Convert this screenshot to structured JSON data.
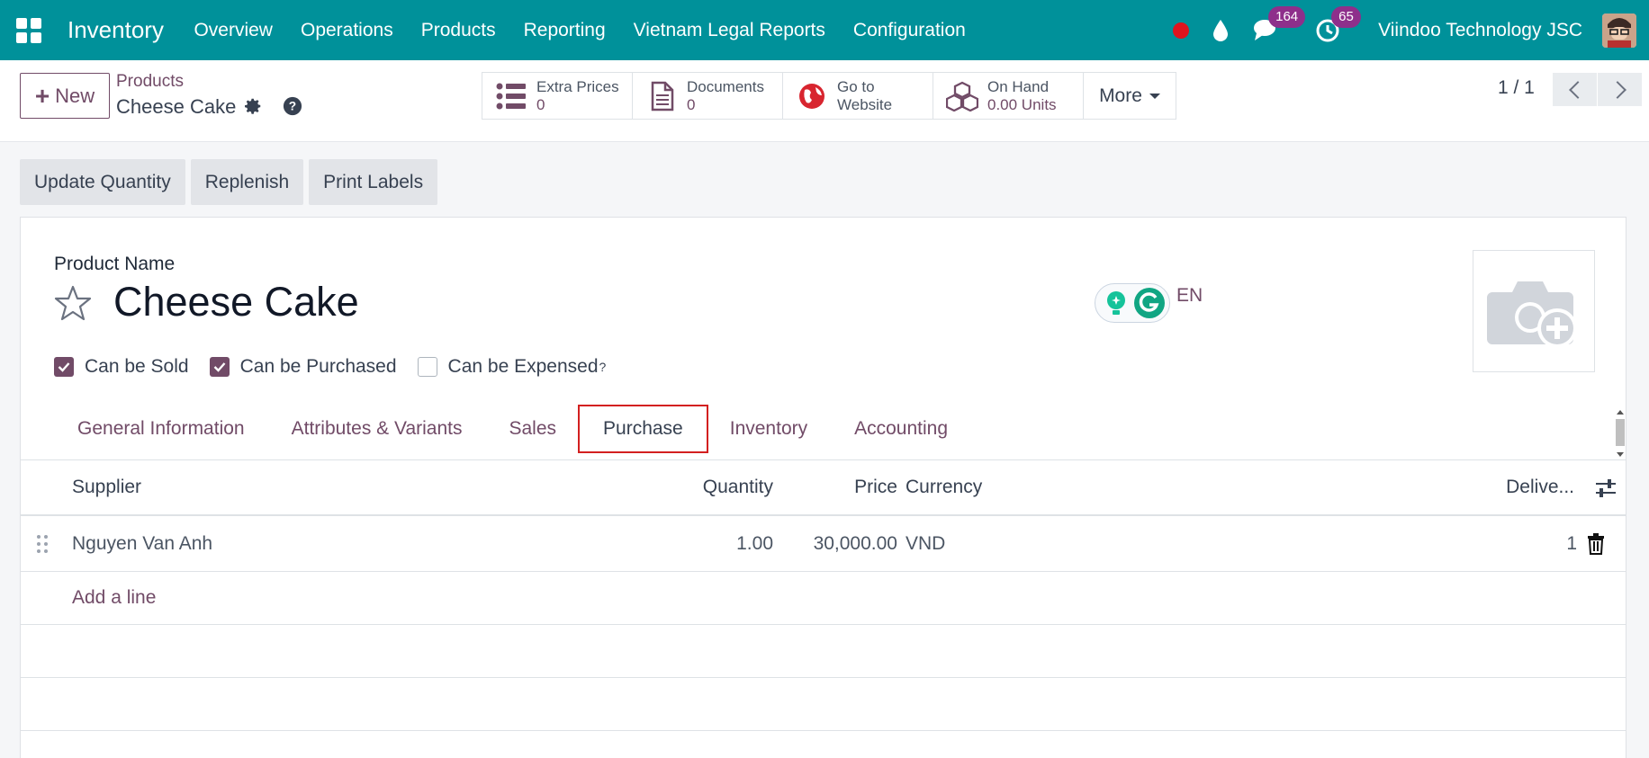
{
  "navbar": {
    "app_name": "Inventory",
    "menu": [
      "Overview",
      "Operations",
      "Products",
      "Reporting",
      "Vietnam Legal Reports",
      "Configuration"
    ],
    "messages_count": "164",
    "activities_count": "65",
    "company": "Viindoo Technology JSC",
    "accent": "#00919a",
    "badge_color": "#8e2f8b"
  },
  "control": {
    "new_label": "New",
    "breadcrumb_parent": "Products",
    "breadcrumb_current": "Cheese Cake",
    "smart_buttons": [
      {
        "icon": "list-icon",
        "label": "Extra Prices",
        "value": "0"
      },
      {
        "icon": "document-icon",
        "label": "Documents",
        "value": "0"
      },
      {
        "icon": "globe-icon",
        "label": "Go to",
        "value": "Website"
      },
      {
        "icon": "cubes-icon",
        "label": "On Hand",
        "value": "0.00 Units"
      }
    ],
    "more_label": "More",
    "pager": "1 / 1"
  },
  "actions": [
    "Update Quantity",
    "Replenish",
    "Print Labels"
  ],
  "form": {
    "product_name_label": "Product Name",
    "product_name": "Cheese Cake",
    "lang": "EN",
    "checkboxes": [
      {
        "label": "Can be Sold",
        "checked": true
      },
      {
        "label": "Can be Purchased",
        "checked": true
      },
      {
        "label": "Can be Expensed",
        "checked": false,
        "help": "?"
      }
    ],
    "tabs": [
      "General Information",
      "Attributes & Variants",
      "Sales",
      "Purchase",
      "Inventory",
      "Accounting"
    ],
    "active_tab": "Purchase"
  },
  "vendor_table": {
    "headers": {
      "supplier": "Supplier",
      "quantity": "Quantity",
      "price": "Price",
      "currency": "Currency",
      "delivery": "Delive..."
    },
    "rows": [
      {
        "supplier": "Nguyen Van Anh",
        "quantity": "1.00",
        "price": "30,000.00",
        "currency": "VND",
        "delivery": "1"
      }
    ],
    "add_line": "Add a line"
  }
}
